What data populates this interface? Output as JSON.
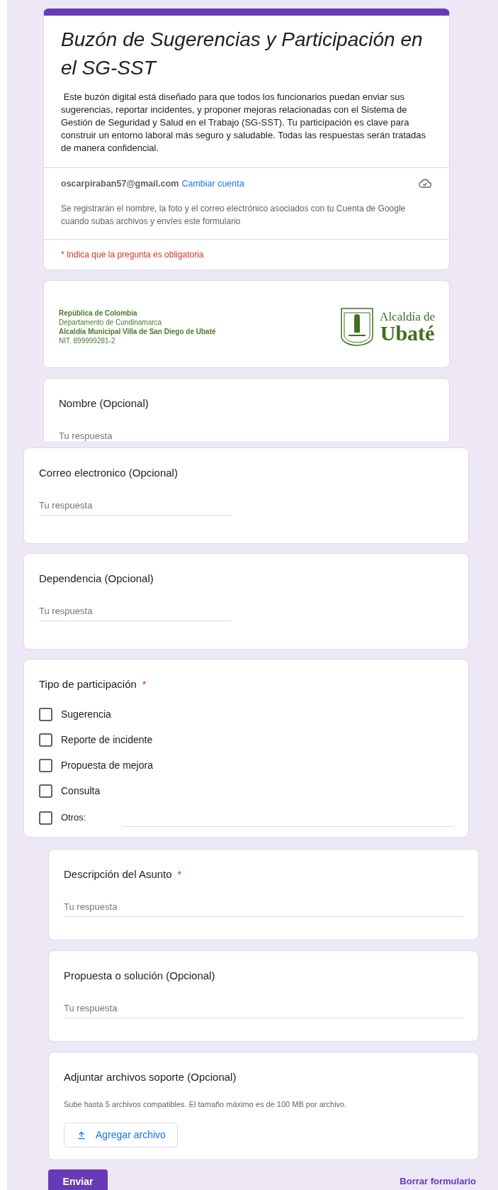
{
  "header": {
    "title": "Buzón de Sugerencias y Participación en el SG-SST",
    "description": " Este buzón digital está diseñado para que todos los funcionarios puedan enviar sus sugerencias, reportar incidentes, y proponer mejoras relacionadas con el Sistema de Gestión de Seguridad y Salud en el Trabajo (SG-SST). Tu participación es clave para construir un entorno laboral más seguro y saludable. Todas las respuestas serán tratadas de manera confidencial.",
    "account": "oscarpiraban57@gmail.com",
    "switch_account": "Cambiar cuenta",
    "notice": "Se registrarán el nombre, la foto y el correo electrónico asociados con tu Cuenta de Google cuando subas archivos y envíes este formulario",
    "required_note": "* Indica que la pregunta es obligatoria"
  },
  "banner": {
    "lines": [
      {
        "text": "República de Colombia",
        "bold": true
      },
      {
        "text": "Departamento de Cundinamarca",
        "bold": false
      },
      {
        "text": "Alcaldía Municipal Villa de San Diego de Ubaté",
        "bold": true
      },
      {
        "text": "NIT. 899999281-2",
        "bold": false
      }
    ],
    "logo_top": "Alcaldía de",
    "logo_bottom": "Ubaté"
  },
  "questions": [
    {
      "kind": "text",
      "title": "Nombre (Opcional)",
      "placeholder": "Tu respuesta"
    },
    {
      "kind": "text",
      "title": "Correo electronico (Opcional)",
      "placeholder": "Tu respuesta"
    },
    {
      "kind": "text",
      "title": "Dependencia (Opcional)",
      "placeholder": "Tu respuesta"
    },
    {
      "kind": "checkbox",
      "title": "Tipo de participación",
      "required_mark": "*",
      "options": [
        {
          "label": "Sugerencia",
          "checked": false,
          "other": false
        },
        {
          "label": "Reporte de incidente",
          "checked": false,
          "other": false
        },
        {
          "label": "Propuesta de mejora",
          "checked": false,
          "other": false
        },
        {
          "label": "Consulta",
          "checked": false,
          "other": false
        },
        {
          "label": "Otros:",
          "checked": false,
          "other": true
        }
      ]
    },
    {
      "kind": "paragraph",
      "title": "Descripción del Asunto",
      "required_mark": "*",
      "placeholder": "Tu respuesta"
    },
    {
      "kind": "paragraph",
      "title": "Propuesta o solución (Opcional)",
      "placeholder": "Tu respuesta"
    },
    {
      "kind": "file",
      "title": "Adjuntar archivos soporte (Opcional)",
      "hint": "Sube hasta 5 archivos compatibles. El tamaño máximo es de 100 MB por archivo.",
      "button": "Agregar archivo"
    }
  ],
  "submit": "Enviar",
  "clear": "Borrar formulario"
}
